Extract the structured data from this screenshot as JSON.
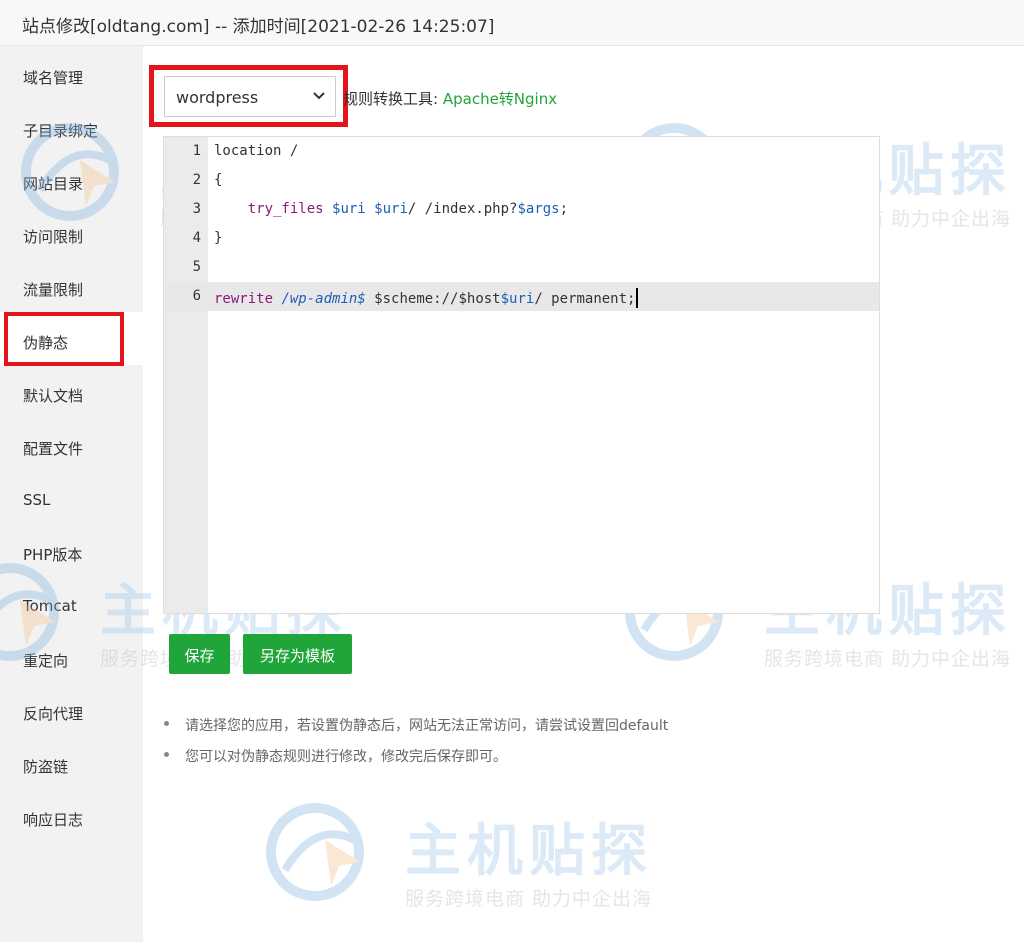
{
  "window": {
    "title": "站点修改[oldtang.com] -- 添加时间[2021-02-26 14:25:07]"
  },
  "sidebar": {
    "items": [
      {
        "label": "域名管理"
      },
      {
        "label": "子目录绑定"
      },
      {
        "label": "网站目录"
      },
      {
        "label": "访问限制"
      },
      {
        "label": "流量限制"
      },
      {
        "label": "伪静态",
        "active": true
      },
      {
        "label": "默认文档"
      },
      {
        "label": "配置文件"
      },
      {
        "label": "SSL"
      },
      {
        "label": "PHP版本"
      },
      {
        "label": "Tomcat"
      },
      {
        "label": "重定向"
      },
      {
        "label": "反向代理"
      },
      {
        "label": "防盗链"
      },
      {
        "label": "响应日志"
      }
    ]
  },
  "rewrite": {
    "selected_template": "wordpress",
    "chevron_icon": "chevron-down-icon",
    "rule_tool_label": "规则转换工具:",
    "rule_tool_link": "Apache转Nginx"
  },
  "editor": {
    "lines": [
      {
        "num": "1",
        "text": "location /"
      },
      {
        "num": "2",
        "text": "{"
      },
      {
        "num": "3",
        "text": "    try_files $uri $uri/ /index.php?$args;"
      },
      {
        "num": "4",
        "text": "}"
      },
      {
        "num": "5",
        "text": ""
      },
      {
        "num": "6",
        "text": "rewrite /wp-admin$ $scheme://$host$uri/ permanent;"
      }
    ],
    "active_line": 6
  },
  "buttons": {
    "save": "保存",
    "save_as_template": "另存为模板"
  },
  "tips": [
    "请选择您的应用，若设置伪静态后，网站无法正常访问，请尝试设置回default",
    "您可以对伪静态规则进行修改，修改完后保存即可。"
  ],
  "watermark": {
    "title": "主机贴探",
    "subtitle": "服务跨境电商 助力中企出海"
  },
  "colors": {
    "accent_green": "#20a53a",
    "highlight_red": "#e3151a",
    "sidebar_bg": "#f2f2f2"
  }
}
